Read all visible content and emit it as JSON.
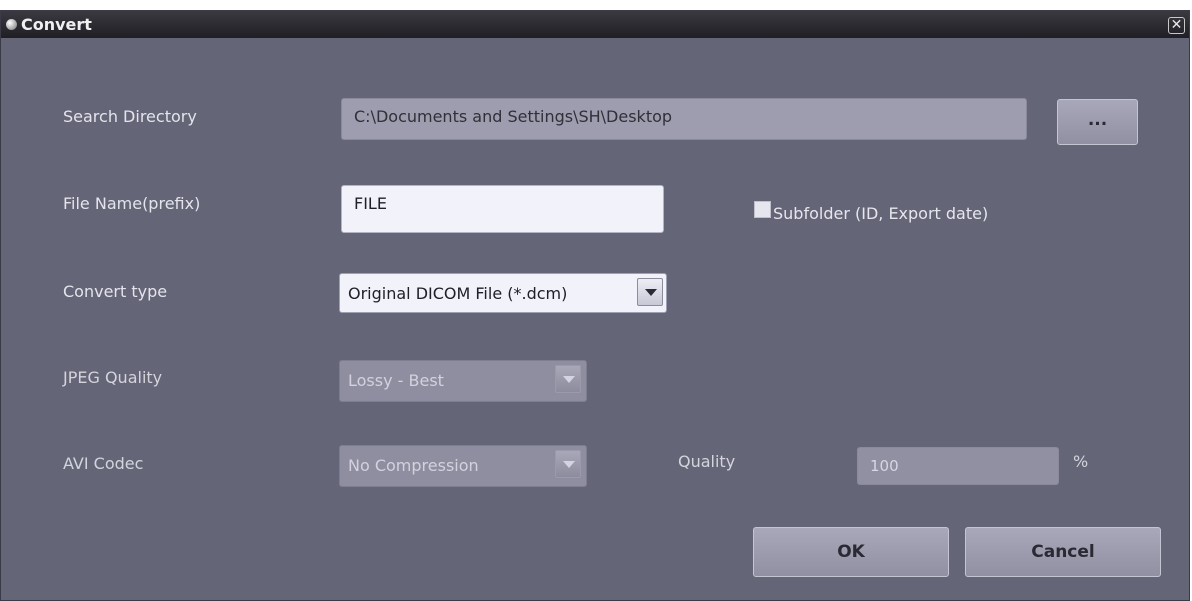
{
  "window": {
    "title": "Convert",
    "close_glyph": "✕"
  },
  "icons": {
    "title": "window-dot-icon",
    "close": "close-icon",
    "dropdown": "chevron-down-icon"
  },
  "search_directory": {
    "label": "Search Directory",
    "value": "C:\\Documents and Settings\\SH\\Desktop",
    "browse_label": "..."
  },
  "file_name": {
    "label": "File Name(prefix)",
    "value": "FILE"
  },
  "subfolder": {
    "label": "Subfolder (ID, Export date)",
    "checked": false
  },
  "convert_type": {
    "label": "Convert type",
    "value": "Original DICOM File (*.dcm)"
  },
  "jpeg_quality": {
    "label": "JPEG Quality",
    "value": "Lossy - Best"
  },
  "avi_codec": {
    "label": "AVI Codec",
    "value": "No Compression"
  },
  "quality": {
    "label": "Quality",
    "value": "100",
    "unit": "%"
  },
  "buttons": {
    "ok": "OK",
    "cancel": "Cancel"
  },
  "colors": {
    "background": "#656578",
    "titlebar": "#2a2a30",
    "field_disabled": "#9d9daf",
    "field_active": "#f2f2fa"
  }
}
